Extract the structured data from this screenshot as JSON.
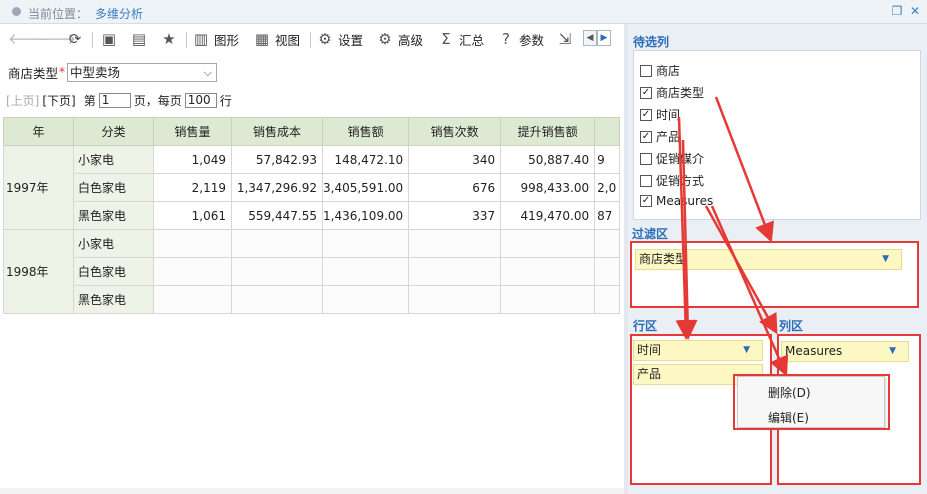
{
  "breadcrumb": {
    "label": "当前位置：",
    "current": "多维分析"
  },
  "window": {
    "restore_icon": "restore-icon",
    "close_icon": "close-icon"
  },
  "toolbar": {
    "chart": "图形",
    "view": "视图",
    "settings": "设置",
    "advanced": "高级",
    "summary": "汇总",
    "params": "参数"
  },
  "filter": {
    "label": "商店类型",
    "required_mark": "*",
    "value": "中型卖场"
  },
  "pager": {
    "prev": "[上页]",
    "next": "[下页]",
    "page_prefix": "第",
    "page": "1",
    "page_suffix": "页，每页",
    "page_size": "100",
    "row_suffix": "行"
  },
  "table": {
    "headers": [
      "年",
      "分类",
      "销售量",
      "销售成本",
      "销售额",
      "销售次数",
      "提升销售额",
      ""
    ],
    "rows": [
      {
        "year": "1997年",
        "cat": "小家电",
        "vals": [
          "1,049",
          "57,842.93",
          "148,472.10",
          "340",
          "50,887.40",
          "9"
        ]
      },
      {
        "year": "",
        "cat": "白色家电",
        "vals": [
          "2,119",
          "1,347,296.92",
          "3,405,591.00",
          "676",
          "998,433.00",
          "2,0"
        ]
      },
      {
        "year": "",
        "cat": "黑色家电",
        "vals": [
          "1,061",
          "559,447.55",
          "1,436,109.00",
          "337",
          "419,470.00",
          "87"
        ]
      },
      {
        "year": "1998年",
        "cat": "小家电",
        "vals": [
          "",
          "",
          "",
          "",
          "",
          ""
        ]
      },
      {
        "year": "",
        "cat": "白色家电",
        "vals": [
          "",
          "",
          "",
          "",
          "",
          ""
        ]
      },
      {
        "year": "",
        "cat": "黑色家电",
        "vals": [
          "",
          "",
          "",
          "",
          "",
          ""
        ]
      }
    ]
  },
  "panel": {
    "available_title": "待选列",
    "columns": [
      {
        "label": "商店",
        "checked": false
      },
      {
        "label": "商店类型",
        "checked": true
      },
      {
        "label": "时间",
        "checked": true
      },
      {
        "label": "产品",
        "checked": true
      },
      {
        "label": "促销媒介",
        "checked": false
      },
      {
        "label": "促销方式",
        "checked": false
      },
      {
        "label": "Measures",
        "checked": true
      }
    ],
    "filter_title": "过滤区",
    "filter_field": "商店类型",
    "row_title": "行区",
    "row_fields": [
      "时间",
      "产品"
    ],
    "col_title": "列区",
    "col_field": "Measures"
  },
  "context_menu": {
    "delete": "删除(D)",
    "edit": "编辑(E)"
  },
  "colors": {
    "accent": "#2a6db5",
    "highlight": "#e53935",
    "header_bg": "#dde9d2",
    "field_bg": "#fdf7c4"
  }
}
